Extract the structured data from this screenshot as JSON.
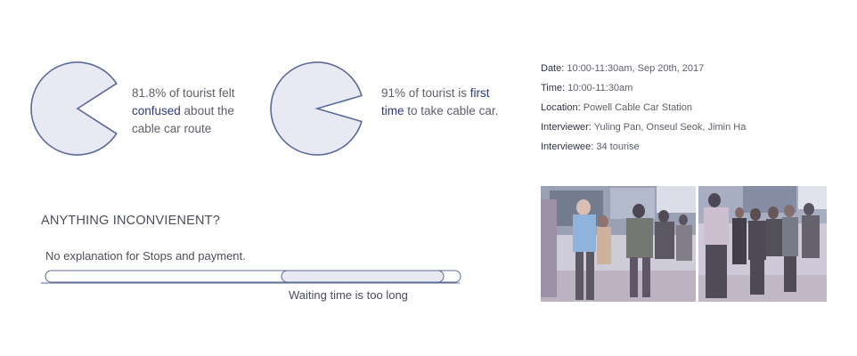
{
  "stats": [
    {
      "percent": 81.8,
      "pre": "81.8% of tourist felt ",
      "highlight": "confused",
      "post": " about the cable car route"
    },
    {
      "percent": 91,
      "pre": "91% of tourist is ",
      "highlight": "first time",
      "post": " to take cable car."
    }
  ],
  "info": {
    "date_label": "Date:",
    "date_value": " 10:00-11:30am, Sep 20th, 2017",
    "time_label": "Time:",
    "time_value": " 10:00-11:30am",
    "location_label": "Location:",
    "location_value": " Powell Cable Car Station",
    "interviewer_label": "Interviewer:",
    "interviewer_value": " Yuling Pan, Onseul Seok, Jimin Ha",
    "interviewee_label": "Interviewee:",
    "interviewee_value": " 34 tourise"
  },
  "inconvenient": {
    "heading": "ANYTHING INCONVIENENT?",
    "item1": "No explanation for Stops and payment.",
    "item2": "Waiting time is too long"
  },
  "colors": {
    "pie_fill": "#e8e9f3",
    "pie_stroke": "#5c6a9a",
    "highlight": "#2c3a7a"
  }
}
